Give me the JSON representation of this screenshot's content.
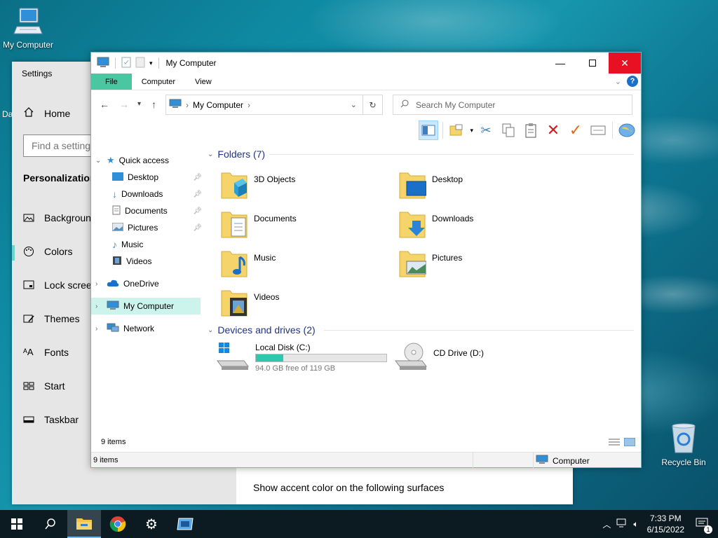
{
  "desktop": {
    "icons": [
      {
        "label": "My Computer"
      },
      {
        "label": "Recycle Bin"
      }
    ],
    "partial_label": "Da"
  },
  "settings": {
    "title": "Settings",
    "home": "Home",
    "find_placeholder": "Find a setting",
    "section": "Personalization",
    "items": [
      "Background",
      "Colors",
      "Lock screen",
      "Themes",
      "Fonts",
      "Start",
      "Taskbar"
    ],
    "main_text": "Show accent color on the following surfaces",
    "accent_color": "#6bd6c8"
  },
  "explorer": {
    "title": "My Computer",
    "tabs": [
      "File",
      "Computer",
      "View"
    ],
    "help_label": "?",
    "address": "My Computer",
    "search_placeholder": "Search My Computer",
    "nav": {
      "quick_access": "Quick access",
      "quick_items": [
        "Desktop",
        "Downloads",
        "Documents",
        "Pictures",
        "Music",
        "Videos"
      ],
      "onedrive": "OneDrive",
      "my_computer": "My Computer",
      "network": "Network"
    },
    "folders_header": "Folders (7)",
    "folders": [
      "3D Objects",
      "Desktop",
      "Documents",
      "Downloads",
      "Music",
      "Pictures",
      "Videos"
    ],
    "drives_header": "Devices and drives (2)",
    "drives": [
      {
        "name": "Local Disk (C:)",
        "free": "94.0 GB free of 119 GB",
        "used_fraction": 0.21
      },
      {
        "name": "CD Drive (D:)"
      }
    ],
    "items_count": "9 items",
    "status_left": "9 items",
    "status_right": "Computer",
    "colors": {
      "file_tab": "#4ac6a0",
      "selected": "#ccf3ec",
      "close": "#e81123",
      "header": "#1e3287"
    }
  },
  "taskbar": {
    "time": "7:33 PM",
    "date": "6/15/2022",
    "notification_count": "1"
  }
}
